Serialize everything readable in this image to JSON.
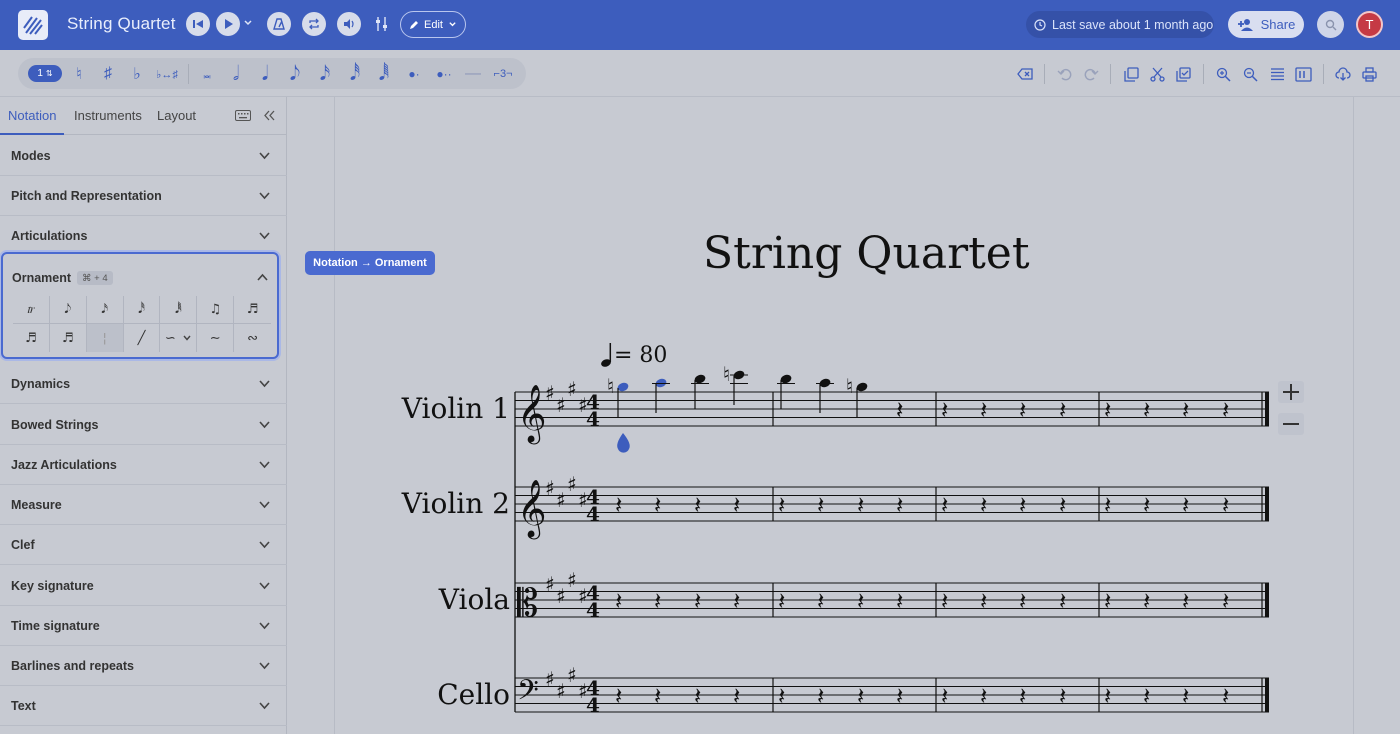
{
  "header": {
    "title": "String Quartet",
    "edit_label": "Edit",
    "last_save": "Last save about 1 month ago",
    "share_label": "Share",
    "avatar_initial": "T"
  },
  "toolbar": {
    "voice_label": "1",
    "icons": [
      "natural-icon",
      "sharp-icon",
      "flat-icon",
      "flip-icon",
      "breve-icon",
      "half-note-icon",
      "quarter-note-icon",
      "eighth-note-icon",
      "16th-note-icon",
      "32nd-note-icon",
      "64th-note-icon",
      "dot-icon",
      "double-dot-icon",
      "tie-icon",
      "tuplet-icon"
    ],
    "right_icons": [
      "delete-icon",
      "undo-icon",
      "redo-icon",
      "copy-icon",
      "cut-icon",
      "paste-icon",
      "zoom-in-icon",
      "zoom-out-icon",
      "list-view-icon",
      "page-view-icon",
      "download-icon",
      "print-icon"
    ]
  },
  "sidebar": {
    "tabs": [
      {
        "label": "Notation"
      },
      {
        "label": "Instruments"
      },
      {
        "label": "Layout"
      }
    ],
    "sections_top": [
      {
        "label": "Modes"
      },
      {
        "label": "Pitch and Representation"
      },
      {
        "label": "Articulations"
      }
    ],
    "ornament": {
      "label": "Ornament",
      "shortcut": "⌘ + 4",
      "items": [
        "𝆖",
        "𝅘𝅥𝅮",
        "𝅘𝅥𝅯",
        "𝅘𝅥𝅰",
        "𝅘𝅥𝅱",
        "♫",
        "♬",
        "♬",
        "♬",
        "¦",
        "╱",
        "∽",
        "∼",
        "∾"
      ]
    },
    "sections_bottom": [
      {
        "label": "Dynamics"
      },
      {
        "label": "Bowed Strings"
      },
      {
        "label": "Jazz Articulations"
      },
      {
        "label": "Measure"
      },
      {
        "label": "Clef"
      },
      {
        "label": "Key signature"
      },
      {
        "label": "Time signature"
      },
      {
        "label": "Barlines and repeats"
      },
      {
        "label": "Text"
      }
    ]
  },
  "score": {
    "breadcrumb": "Notation → Ornament",
    "title": "String Quartet",
    "tempo": "= 80",
    "instruments": [
      "Violin 1",
      "Violin 2",
      "Viola",
      "Cello"
    ],
    "key": "E major",
    "time_signature": "4/4",
    "accent_color": "#3d5dbd"
  }
}
